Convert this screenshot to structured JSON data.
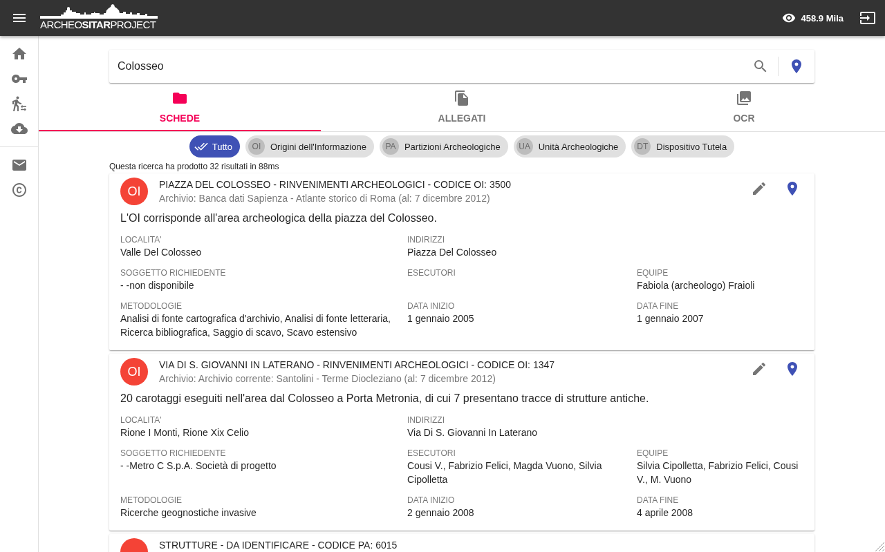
{
  "app_bar": {
    "logo": "ARCHEO**SITAR**PROJECT",
    "views": "458.9 Mila"
  },
  "search": {
    "value": "Colosseo"
  },
  "tabs": [
    {
      "label": "SCHEDE",
      "selected": true
    },
    {
      "label": "ALLEGATI",
      "selected": false
    },
    {
      "label": "OCR",
      "selected": false
    }
  ],
  "filters": [
    {
      "label": "Tutto",
      "selected": true
    },
    {
      "avatar": "OI",
      "label": "Origini dell'Informazione",
      "selected": false
    },
    {
      "avatar": "PA",
      "label": "Partizioni Archeologiche",
      "selected": false
    },
    {
      "avatar": "UA",
      "label": "Unità Archeologiche",
      "selected": false
    },
    {
      "avatar": "DT",
      "label": "Dispositivo Tutela",
      "selected": false
    }
  ],
  "result_summary": "Questa ricerca ha prodotto 32 risultati in 88ms",
  "results": [
    {
      "avatar": "OI",
      "title": "PIAZZA DEL COLOSSEO - RINVENIMENTI ARCHEOLOGICI - CODICE OI: 3500",
      "subtitle": "Archivio: Banca dati Sapienza - Atlante storico di Roma (al: 7 dicembre 2012)",
      "description": "L'OI corrisponde all'area archeologica della piazza del Colosseo.",
      "fields": [
        [
          {
            "label": "LOCALITA'",
            "value": "Valle Del Colosseo"
          },
          {
            "label": "INDIRIZZI",
            "value": "Piazza Del Colosseo"
          }
        ],
        [
          {
            "label": "SOGGETTO RICHIEDENTE",
            "value": "- -non disponibile"
          },
          {
            "label": "ESECUTORI"
          },
          {
            "label": "EQUIPE",
            "value": "Fabiola (archeologo) Fraioli"
          }
        ],
        [
          {
            "label": "METODOLOGIE",
            "value": "Analisi di fonte cartografica d'archivio, Analisi di fonte letteraria, Ricerca bibliografica, Saggio di scavo, Scavo estensivo"
          },
          {
            "label": "DATA INIZIO",
            "value": "1 gennaio 2005"
          },
          {
            "label": "DATA FINE",
            "value": "1 gennaio 2007"
          }
        ]
      ]
    },
    {
      "avatar": "OI",
      "title": "VIA DI S. GIOVANNI IN LATERANO - RINVENIMENTI ARCHEOLOGICI - CODICE OI: 1347",
      "subtitle": "Archivio: Archivio corrente: Santolini - Terme Diocleziano (al: 7 dicembre 2012)",
      "description": "20 carotaggi eseguiti nell'area dal Colosseo a Porta Metronia, di cui 7 presentano tracce di strutture antiche.",
      "fields": [
        [
          {
            "label": "LOCALITA'",
            "value": "Rione I Monti, Rione Xix Celio"
          },
          {
            "label": "INDIRIZZI",
            "value": "Via Di S. Giovanni In Laterano"
          }
        ],
        [
          {
            "label": "SOGGETTO RICHIEDENTE",
            "value": "- -Metro C S.p.A. Società di progetto"
          },
          {
            "label": "ESECUTORI",
            "value": "Cousi V., Fabrizio Felici, Magda Vuono, Silvia Cipolletta"
          },
          {
            "label": "EQUIPE",
            "value": "Silvia Cipolletta, Fabrizio Felici, Cousi V., M. Vuono"
          }
        ],
        [
          {
            "label": "METODOLOGIE",
            "value": "Ricerche geognostiche invasive"
          },
          {
            "label": "DATA INIZIO",
            "value": "2 gennaio 2008"
          },
          {
            "label": "DATA FINE",
            "value": "4 aprile 2008"
          }
        ]
      ]
    },
    {
      "title": "STRUTTURE - DA IDENTIFICARE - CODICE PA: 6015"
    }
  ]
}
